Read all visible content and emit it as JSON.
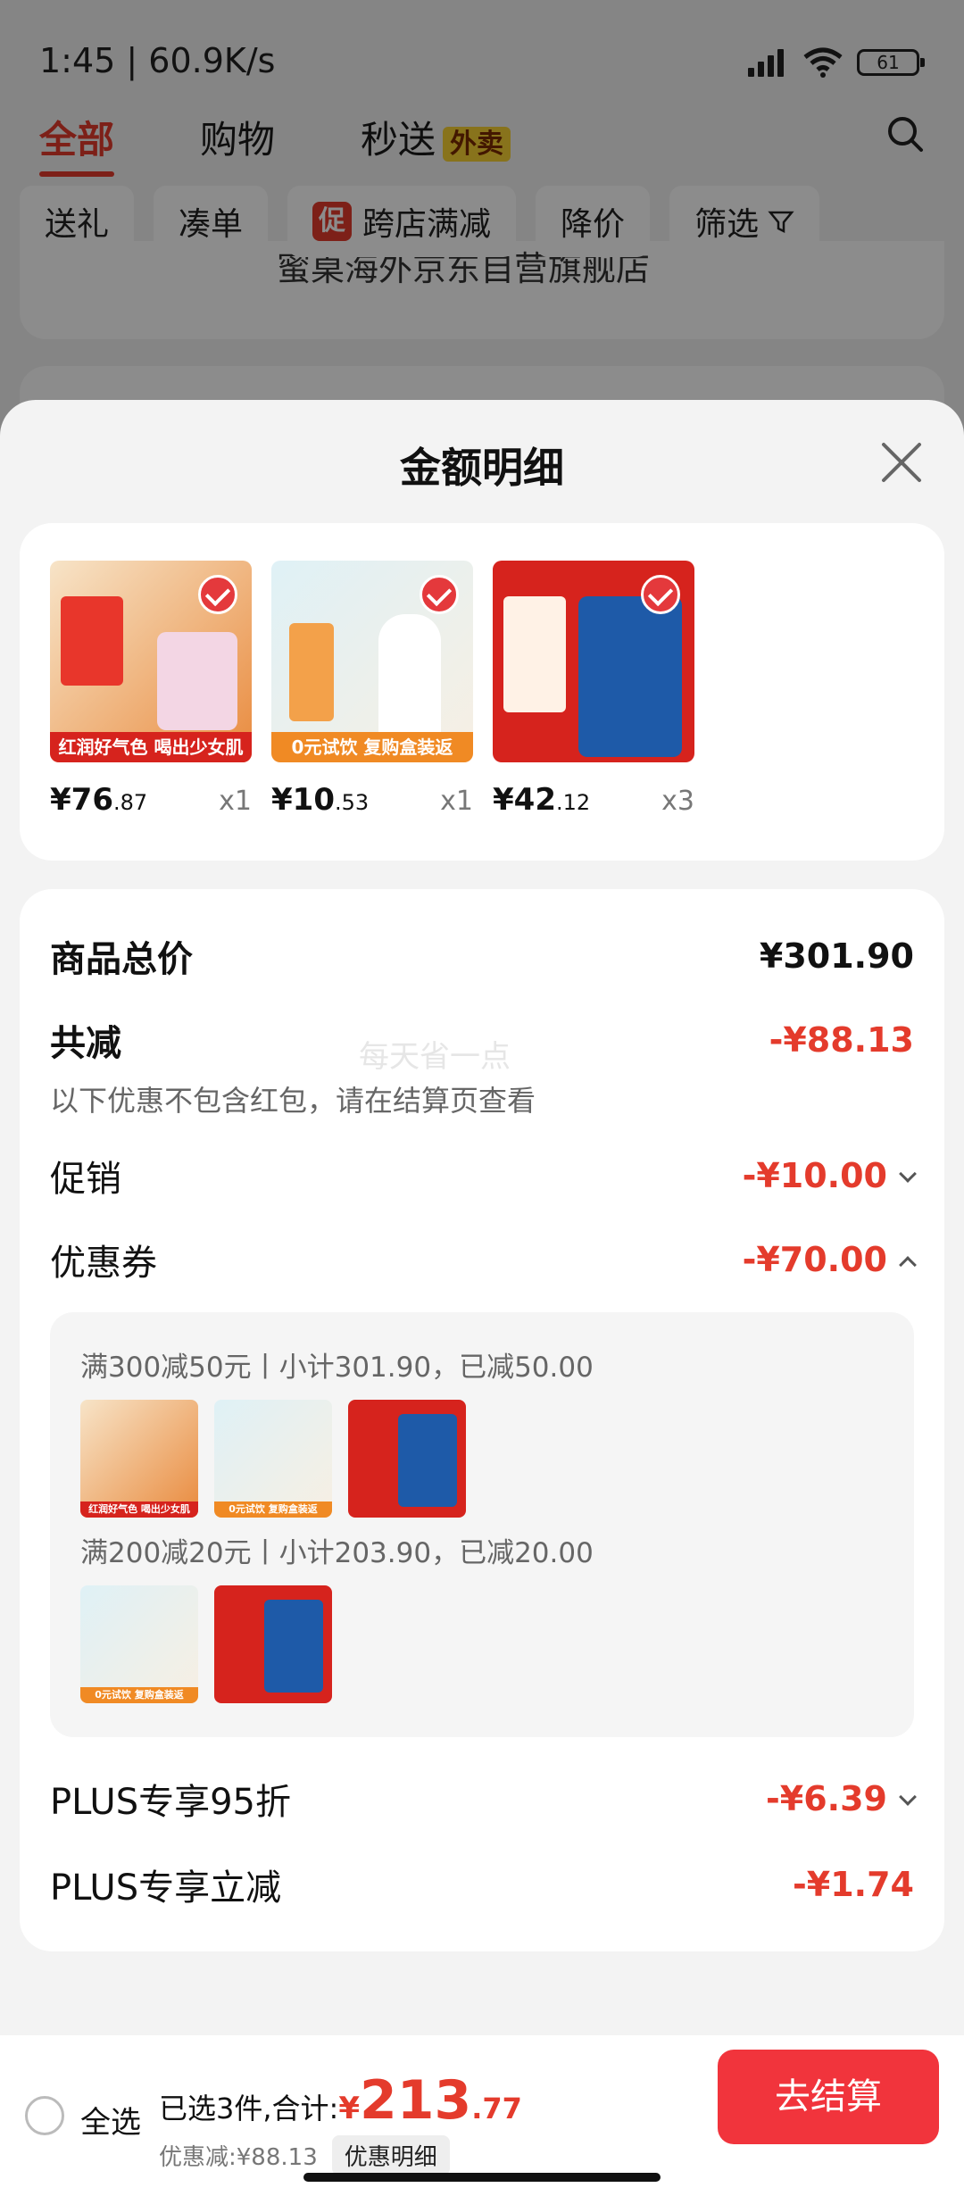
{
  "status": {
    "time": "1:45 | 60.9K/s",
    "battery": "61"
  },
  "top_tabs": {
    "all": "全部",
    "shopping": "购物",
    "express": "秒送",
    "express_badge": "外卖"
  },
  "chips": [
    "送礼",
    "凑单",
    "跨店满减",
    "降价",
    "筛选"
  ],
  "chip_badge": "促",
  "bg_store": "蜜桌海外京东自营旗舰店",
  "sheet": {
    "title": "金额明细"
  },
  "products": [
    {
      "price_int": "¥76",
      "price_dec": ".87",
      "qty": "x1",
      "banner": "红润好气色 喝出少女肌",
      "colors": [
        "#f7e4c8",
        "#e98a3d"
      ]
    },
    {
      "price_int": "¥10",
      "price_dec": ".53",
      "qty": "x1",
      "banner": "0元试饮 复购盒装返",
      "colors": [
        "#dff1f6",
        "#f3a14a"
      ]
    },
    {
      "price_int": "¥42",
      "price_dec": ".12",
      "qty": "x3",
      "banner": "",
      "colors": [
        "#d6231d",
        "#1e5aa8"
      ]
    }
  ],
  "details": {
    "subtotal_label": "商品总价",
    "subtotal_value": "¥301.90",
    "total_off_label": "共减",
    "total_off_value": "-¥88.13",
    "note": "以下优惠不包含红包，请在结算页查看",
    "watermark": "每天省一点",
    "promo_label": "促销",
    "promo_value": "-¥10.00",
    "coupon_label": "优惠券",
    "coupon_value": "-¥70.00",
    "coupon_line1": "满300减50元丨小计301.90，已减50.00",
    "coupon_line2": "满200减20元丨小计203.90，已减20.00",
    "plus95_label": "PLUS专享95折",
    "plus95_value": "-¥6.39",
    "plusoff_label": "PLUS专享立减",
    "plusoff_value": "-¥1.74"
  },
  "bottom": {
    "select_all": "全选",
    "selected_text": "已选3件,合计:",
    "currency": "¥",
    "total_int": "213",
    "total_dec": ".77",
    "discount_text": "优惠减:¥88.13",
    "detail_btn": "优惠明细",
    "checkout": "去结算"
  },
  "colors": {
    "accent": "#e43b2c",
    "checkout": "#f1343c"
  }
}
